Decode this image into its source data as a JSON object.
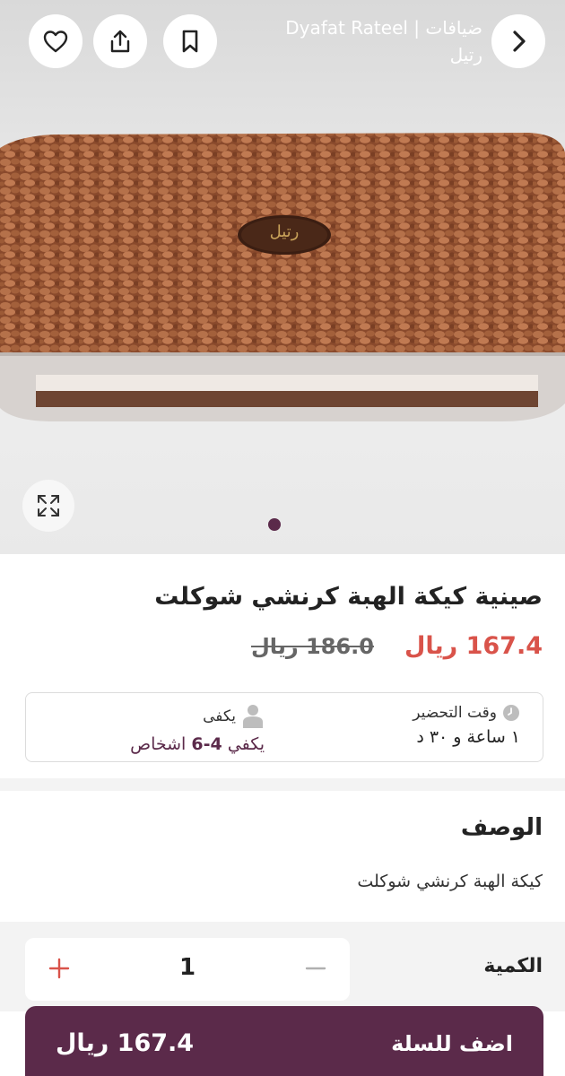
{
  "header": {
    "store_name": "ضيافات | Dyafat Rateel رتيل",
    "icons": [
      "back-chevron-icon",
      "bookmark-icon",
      "share-icon",
      "heart-icon"
    ]
  },
  "gallery": {
    "image_alt": "صينية كيكة الهبة كرنشي شوكلت",
    "logo_text": "رتيل",
    "expand_icon": "expand-icon",
    "page_index": 1,
    "page_count": 1
  },
  "product": {
    "title": "صينية كيكة الهبة كرنشي شوكلت",
    "price": "167.4 ريال",
    "old_price": "186.0 ريال"
  },
  "info": {
    "prep_label": "وقت التحضير",
    "prep_value": "١ ساعة و ٣٠ د",
    "serves_label": "يكفى",
    "serves_value_prefix": "يكفي ",
    "serves_value_range": "4-6",
    "serves_value_suffix": " اشخاص"
  },
  "description": {
    "heading": "الوصف",
    "text": "كيكة الهبة كرنشي شوكلت"
  },
  "quantity": {
    "label": "الكمية",
    "value": "1"
  },
  "cart": {
    "label": "اضف للسلة",
    "price": "167.4 ريال"
  },
  "colors": {
    "brand": "#5b2a4a",
    "price_red": "#d9534a"
  }
}
